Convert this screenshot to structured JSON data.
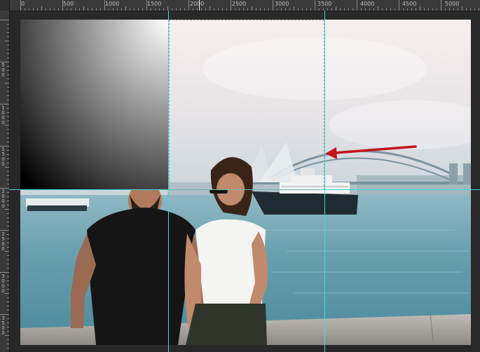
{
  "ruler": {
    "horizontal_labels": [
      "0",
      "500",
      "1000",
      "1500",
      "2000",
      "2500",
      "3000",
      "3500",
      "4000",
      "4500",
      "5000"
    ],
    "vertical_labels": [
      "5 0 0",
      "1 0 0 0",
      "1 5 0 0",
      "2 0 0 0",
      "2 5 0 0",
      "3 0 0 0",
      "3 5 0 0"
    ]
  },
  "canvas": {
    "photo_subject": "couple-on-harbour-pier",
    "overlay": "black-to-white-gradient-square",
    "annotation": "red-arrow-pointing-left"
  },
  "colors": {
    "workspace": "#282828",
    "ruler": "#3a3a3a",
    "guide": "#43d7d7",
    "arrow": "#c4141a",
    "water": "#5f97a6",
    "sky": "#f5eeec"
  }
}
